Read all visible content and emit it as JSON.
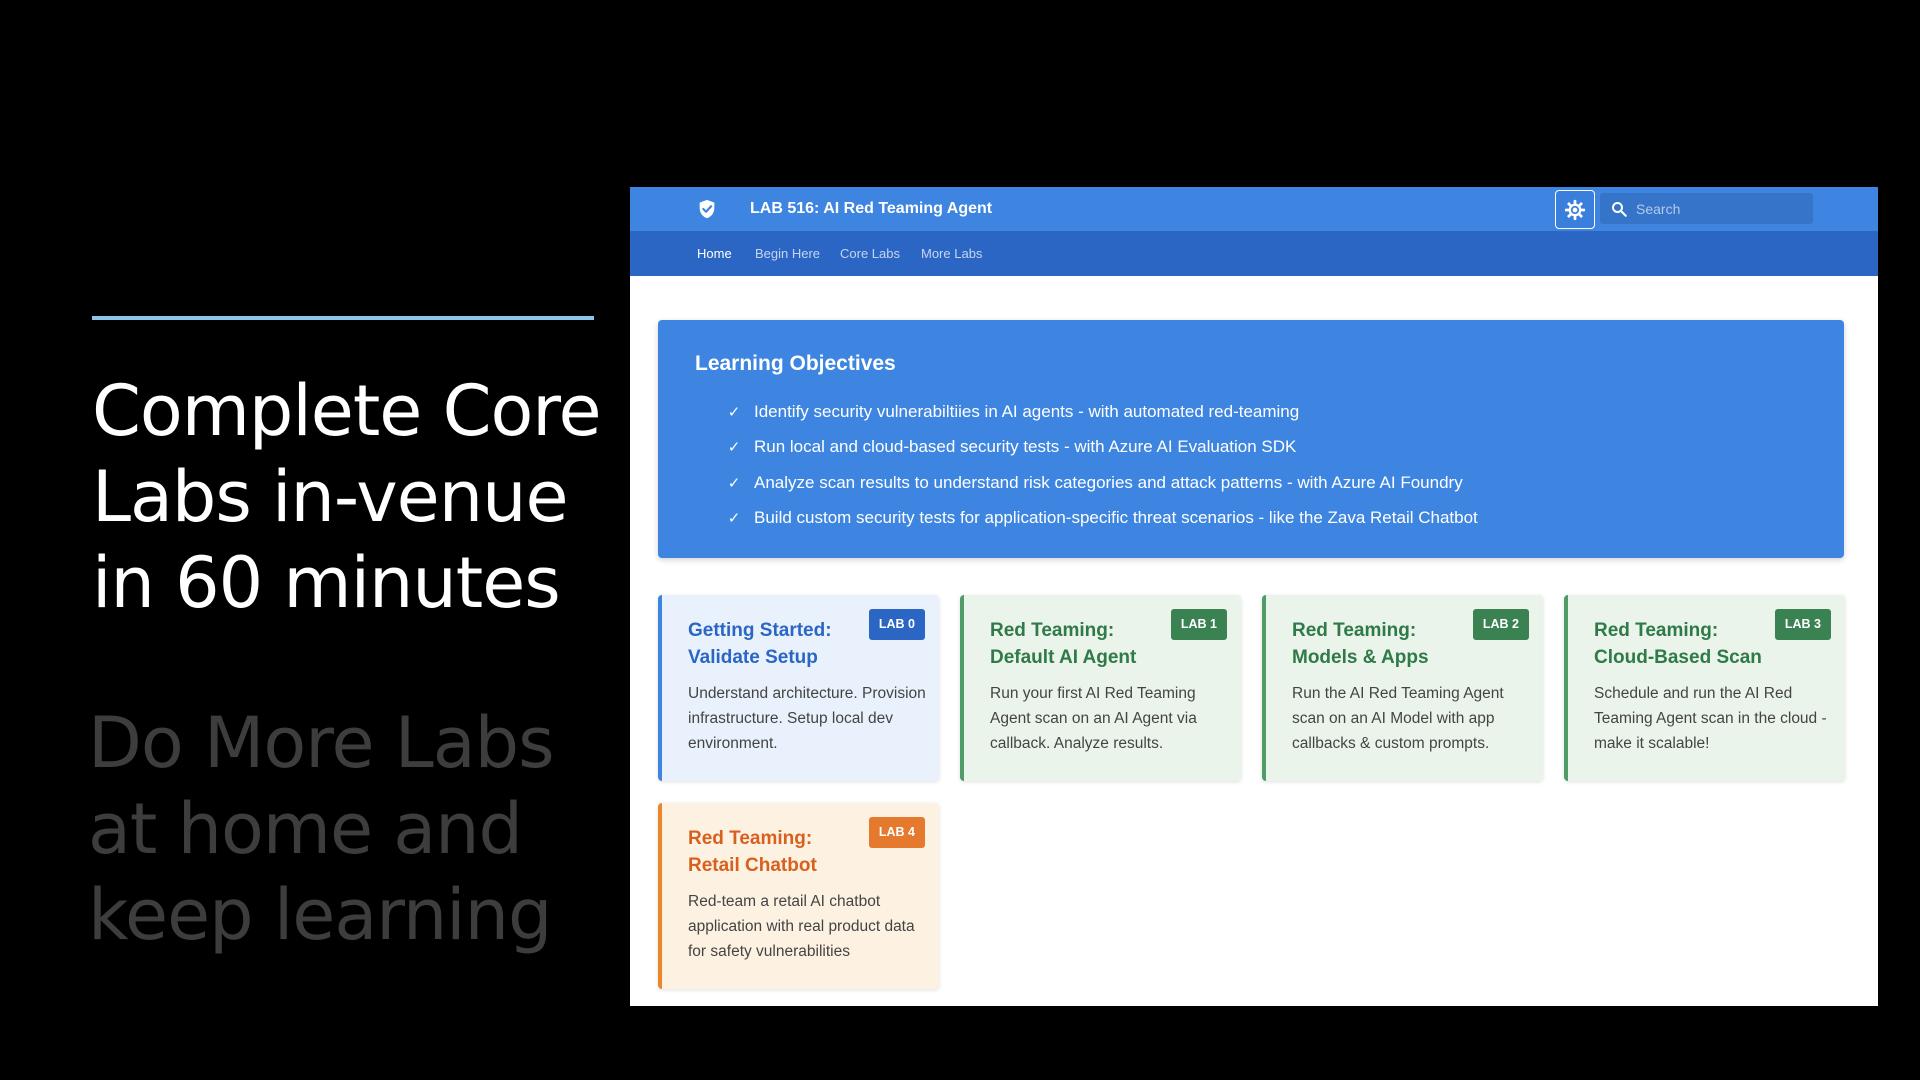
{
  "slide": {
    "headline": [
      "Complete Core",
      "Labs in-venue",
      "in 60 minutes"
    ],
    "subline": [
      "Do More Labs",
      "at home and",
      "keep learning"
    ]
  },
  "header": {
    "title": "LAB 516: AI Red Teaming Agent",
    "logo_icon": "shield-check-icon",
    "theme_icon": "brightness-icon",
    "search": {
      "placeholder": "Search",
      "icon": "search-icon"
    }
  },
  "nav": {
    "items": [
      {
        "label": "Home",
        "active": true
      },
      {
        "label": "Begin Here",
        "active": false
      },
      {
        "label": "Core Labs",
        "active": false
      },
      {
        "label": "More Labs",
        "active": false
      }
    ]
  },
  "objectives": {
    "title": "Learning Objectives",
    "items": [
      "Identify security vulnerabiltiies in AI agents - with automated red-teaming",
      "Run local and cloud-based security tests - with Azure AI Evaluation SDK",
      "Analyze scan results to understand risk categories and attack patterns - with Azure AI Foundry",
      "Build custom security tests for application-specific threat scenarios - like the Zava Retail Chatbot"
    ]
  },
  "labs": [
    {
      "badge": "LAB 0",
      "title": "Getting Started:\nValidate Setup",
      "description": "Understand architecture. Provision infrastructure. Setup local dev environment.",
      "color": "#2c66c4"
    },
    {
      "badge": "LAB 1",
      "title": "Red Teaming:\nDefault AI Agent",
      "description": "Run your first AI Red Teaming Agent scan on an AI Agent via callback. Analyze results.",
      "color": "#3b8252"
    },
    {
      "badge": "LAB 2",
      "title": "Red Teaming:\nModels & Apps",
      "description": "Run the AI Red Teaming Agent scan on an AI Model with app callbacks & custom prompts.",
      "color": "#3b8252"
    },
    {
      "badge": "LAB 3",
      "title": "Red Teaming:\nCloud-Based Scan",
      "description": "Schedule and run the AI Red Teaming Agent scan in the cloud - make it scalable!",
      "color": "#3b8252"
    },
    {
      "badge": "LAB 4",
      "title": "Red Teaming:\nRetail Chatbot",
      "description": "Red-team a retail AI chatbot application with real product data for safety vulnerabilities",
      "color": "#e57a2e"
    }
  ],
  "colors": {
    "header_bg": "#3d85e0",
    "nav_bg": "#2c66c4",
    "accent_rule": "#8fc4ea"
  }
}
